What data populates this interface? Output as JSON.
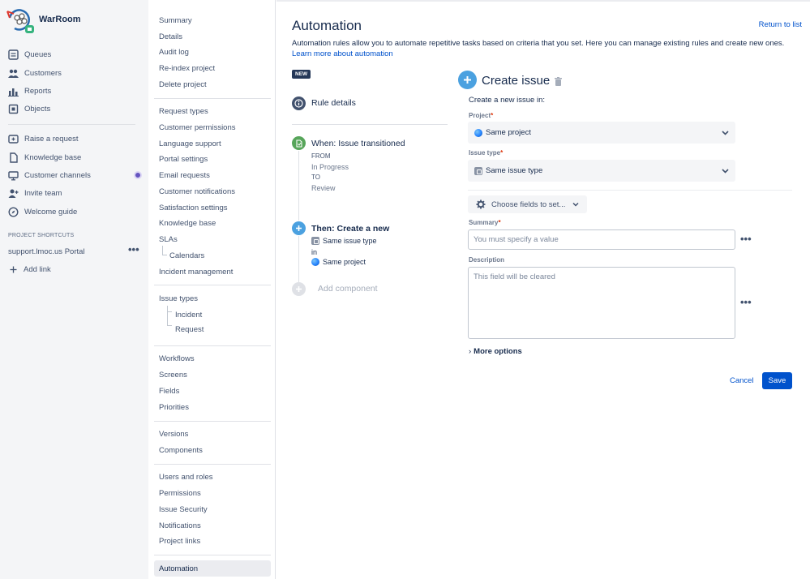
{
  "app": {
    "title": "WarRoom"
  },
  "leftnav": {
    "items": [
      {
        "label": "Queues",
        "icon": "queues-icon"
      },
      {
        "label": "Customers",
        "icon": "customers-icon"
      },
      {
        "label": "Reports",
        "icon": "reports-icon"
      },
      {
        "label": "Objects",
        "icon": "objects-icon"
      },
      {
        "label": "Raise a request",
        "icon": "raise-request-icon"
      },
      {
        "label": "Knowledge base",
        "icon": "knowledge-base-icon"
      },
      {
        "label": "Customer channels",
        "icon": "customer-channels-icon"
      },
      {
        "label": "Invite team",
        "icon": "invite-team-icon"
      },
      {
        "label": "Welcome guide",
        "icon": "welcome-guide-icon"
      }
    ],
    "shortcuts_heading": "PROJECT SHORTCUTS",
    "shortcut": "support.lmoc.us Portal",
    "add_link": "Add link"
  },
  "settings": {
    "group1": [
      "Summary",
      "Details",
      "Audit log",
      "Re-index project",
      "Delete project"
    ],
    "group2": [
      "Request types",
      "Customer permissions",
      "Language support",
      "Portal settings",
      "Email requests",
      "Customer notifications",
      "Satisfaction settings",
      "Knowledge base",
      "SLAs",
      "Calendars",
      "Incident management"
    ],
    "group3": [
      "Issue types",
      "Incident",
      "Request"
    ],
    "group4": [
      "Workflows",
      "Screens",
      "Fields",
      "Priorities"
    ],
    "group5": [
      "Versions",
      "Components"
    ],
    "group6": [
      "Users and roles",
      "Permissions",
      "Issue Security",
      "Notifications",
      "Project links"
    ],
    "active": "Automation"
  },
  "main": {
    "title": "Automation",
    "return_link": "Return to list",
    "intro_text": "Automation rules allow you to automate repetitive tasks based on criteria that you set. Here you can manage existing rules and create new ones. ",
    "intro_link": "Learn more about automation",
    "new_badge": "NEW",
    "rule_details": "Rule details",
    "trigger": {
      "title": "When: Issue transitioned",
      "from_label": "FROM",
      "from_value": "In Progress",
      "to_label": "TO",
      "to_value": "Review"
    },
    "action": {
      "title": "Then: Create a new",
      "issue_type": "Same issue type",
      "in_label": "in",
      "project": "Same project"
    },
    "add_component": "Add component"
  },
  "panel": {
    "title": "Create issue",
    "subtitle": "Create a new issue in:",
    "project_label": "Project",
    "project_value": "Same project",
    "issue_type_label": "Issue type",
    "issue_type_value": "Same issue type",
    "choose_fields": "Choose fields to set...",
    "summary_label": "Summary",
    "summary_placeholder": "You must specify a value",
    "description_label": "Description",
    "description_placeholder": "This field will be cleared",
    "more_options": "More options",
    "cancel": "Cancel",
    "save": "Save",
    "required_mark": "*"
  },
  "colors": {
    "accent": "#0052cc",
    "required": "#de350b",
    "trigger_green": "#57a55a",
    "action_blue": "#4ba1e0"
  }
}
